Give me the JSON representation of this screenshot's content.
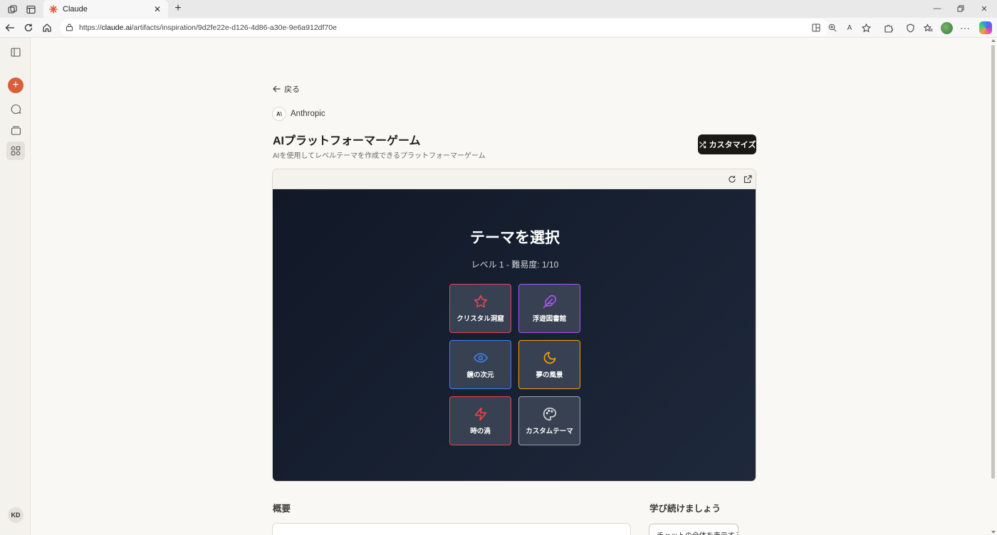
{
  "browser": {
    "tab_title": "Claude",
    "url_prefix": "https://",
    "url_host": "claude.ai",
    "url_path": "/artifacts/inspiration/9d2fe22e-d126-4d86-a30e-9e6a912df70e",
    "read_aloud_label": "A",
    "icons": [
      "workspaces-icon",
      "tab-actions-icon",
      "claude-favicon",
      "close-tab-icon",
      "new-tab-icon",
      "minimize-icon",
      "restore-icon",
      "close-window-icon",
      "back-icon",
      "refresh-icon",
      "home-icon",
      "site-info-icon",
      "split-screen-icon",
      "zoom-icon",
      "read-aloud-icon",
      "favorite-star-icon",
      "extensions-icon",
      "browser-essentials-icon",
      "favorites-icon",
      "profile-avatar",
      "more-icon",
      "copilot-icon"
    ]
  },
  "sidebar": {
    "user_initials": "KD",
    "icons": [
      "sidebar-toggle-icon",
      "new-chat-icon",
      "chats-icon",
      "projects-icon",
      "artifacts-icon"
    ]
  },
  "page": {
    "back_label": "戻る",
    "author": "Anthropic",
    "author_logo": "A\\",
    "title": "AIプラットフォーマーゲーム",
    "subtitle": "AIを使用してレベルテーマを作成できるプラットフォーマーゲーム",
    "customize_label": "カスタマイズ"
  },
  "game": {
    "heading": "テーマを選択",
    "level_text": "レベル 1 - 難易度: 1/10",
    "themes": [
      {
        "label": "クリスタル洞窟",
        "icon": "star-icon",
        "color": "#e0455a"
      },
      {
        "label": "浮遊図書館",
        "icon": "feather-icon",
        "color": "#a855f7"
      },
      {
        "label": "鏡の次元",
        "icon": "eye-icon",
        "color": "#3b82f6"
      },
      {
        "label": "夢の風景",
        "icon": "moon-icon",
        "color": "#f59e0b"
      },
      {
        "label": "時の渦",
        "icon": "zap-icon",
        "color": "#ef4444"
      },
      {
        "label": "カスタムテーマ",
        "icon": "palette-icon",
        "color": "#9ca3af"
      }
    ]
  },
  "sections": {
    "overview": "概要",
    "keep_learning": "学び続けましょう",
    "chat_button": "チャットの全体を表示する"
  },
  "colors": {
    "accent": "#d95f39",
    "game_bg_start": "#111827",
    "game_bg_end": "#1e293b",
    "card_bg": "#374151"
  }
}
